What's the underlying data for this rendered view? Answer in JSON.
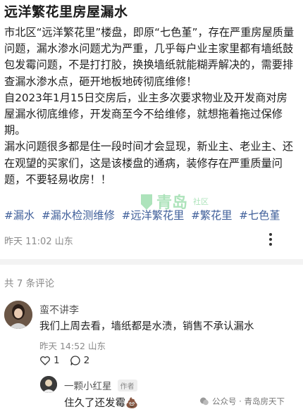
{
  "post": {
    "title": "远洋繁花里房屋漏水",
    "paragraphs": [
      "市北区“远洋繁花里”楼盘，即原“七色堇”，存在严重房屋质量问题，漏水渗水问题尤为严重，几乎每户业主家里都有墙纸鼓包发霉问题，不是打打胶，换换墙纸就能糊弄解决的，需要排查漏水渗水点，砸开地板地砖彻底维修！",
      "自2023年1月15日交房后，业主多次要求物业及开发商对房屋漏水彻底维修，开发商至今不给维修，就想拖着拖过保修期。",
      "漏水问题很多都是住一段时间才会显现，新业主、老业主、还在观望的买家们，这是该楼盘的通病，装修存在严重质量问题，不要轻易收房！！"
    ],
    "tags": [
      "#漏水",
      "#漏水检测维修",
      "#远洋繁花里",
      "#繁花里",
      "#七色堇"
    ],
    "meta": "昨天 11:02 山东"
  },
  "watermark": {
    "brand": "青岛",
    "suffix": "社区"
  },
  "comments": {
    "count_label": "共 7 条评论",
    "items": [
      {
        "name": "蛮不讲李",
        "text": "我们上周去看，墙纸都是水渍，销售不承认漏水",
        "meta": "昨天 14:52 山东",
        "likes": "1",
        "replies": "2"
      }
    ],
    "reply": {
      "name": "一颗小红星",
      "badge": "作者",
      "text": "住久了还发霉💩"
    }
  },
  "source_watermark": "公众号 · 青岛房天下"
}
